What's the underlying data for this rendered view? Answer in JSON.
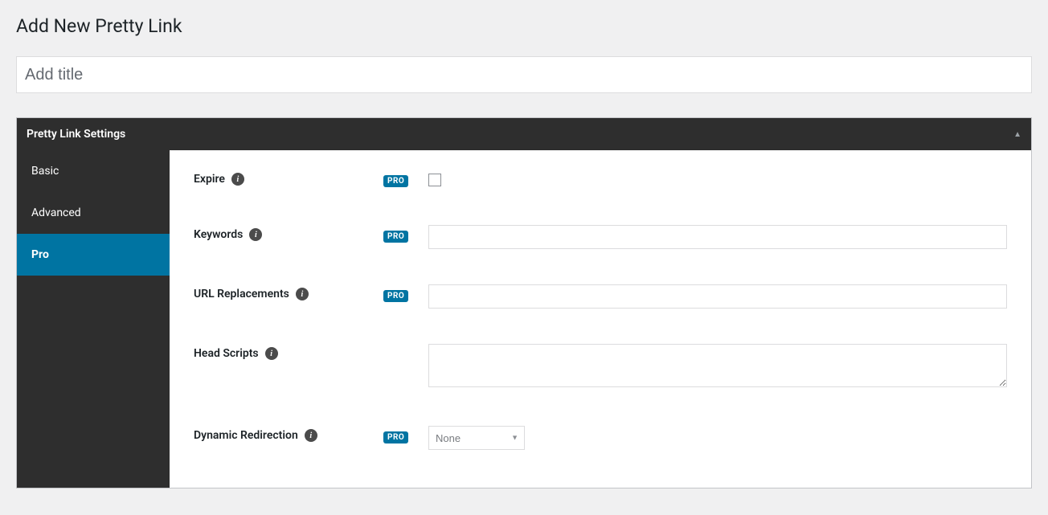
{
  "page": {
    "title": "Add New Pretty Link",
    "title_input_placeholder": "Add title",
    "title_input_value": ""
  },
  "metabox": {
    "header": "Pretty Link Settings"
  },
  "tabs": [
    {
      "label": "Basic",
      "active": false
    },
    {
      "label": "Advanced",
      "active": false
    },
    {
      "label": "Pro",
      "active": true
    }
  ],
  "pro_badge": "PRO",
  "rows": {
    "expire": {
      "label": "Expire",
      "value": ""
    },
    "keywords": {
      "label": "Keywords",
      "value": ""
    },
    "url_replacements": {
      "label": "URL Replacements",
      "value": ""
    },
    "head_scripts": {
      "label": "Head Scripts",
      "value": ""
    },
    "dynamic_redirection": {
      "label": "Dynamic Redirection",
      "selected": "None"
    }
  }
}
